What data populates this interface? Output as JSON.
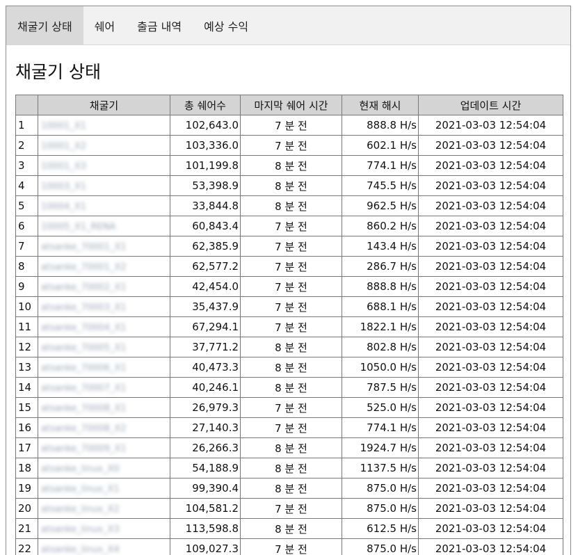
{
  "tabs": [
    {
      "label": "채굴기 상태",
      "active": true
    },
    {
      "label": "쉐어",
      "active": false
    },
    {
      "label": "출금 내역",
      "active": false
    },
    {
      "label": "예상 수익",
      "active": false
    }
  ],
  "page_title": "채굴기 상태",
  "table": {
    "headers": [
      "",
      "채굴기",
      "총 쉐어수",
      "마지막 쉐어 시간",
      "현재 해시",
      "업데이트 시간"
    ],
    "rows": [
      {
        "idx": "1",
        "name": "10001_X1",
        "shares": "102,643.0",
        "last": "7 분 전",
        "hash": "888.8 H/s",
        "updated": "2021-03-03 12:54:04"
      },
      {
        "idx": "2",
        "name": "10001_X2",
        "shares": "103,336.0",
        "last": "7 분 전",
        "hash": "602.1 H/s",
        "updated": "2021-03-03 12:54:04"
      },
      {
        "idx": "3",
        "name": "10001_X3",
        "shares": "101,199.8",
        "last": "8 분 전",
        "hash": "774.1 H/s",
        "updated": "2021-03-03 12:54:04"
      },
      {
        "idx": "4",
        "name": "10003_X1",
        "shares": "53,398.9",
        "last": "8 분 전",
        "hash": "745.5 H/s",
        "updated": "2021-03-03 12:54:04"
      },
      {
        "idx": "5",
        "name": "10004_X1",
        "shares": "33,844.8",
        "last": "8 분 전",
        "hash": "962.5 H/s",
        "updated": "2021-03-03 12:54:04"
      },
      {
        "idx": "6",
        "name": "10005_X1_RENA",
        "shares": "60,843.4",
        "last": "7 분 전",
        "hash": "860.2 H/s",
        "updated": "2021-03-03 12:54:04"
      },
      {
        "idx": "7",
        "name": "atsanke_70001_X1",
        "shares": "62,385.9",
        "last": "7 분 전",
        "hash": "143.4 H/s",
        "updated": "2021-03-03 12:54:04"
      },
      {
        "idx": "8",
        "name": "atsanke_70001_X2",
        "shares": "62,577.2",
        "last": "7 분 전",
        "hash": "286.7 H/s",
        "updated": "2021-03-03 12:54:04"
      },
      {
        "idx": "9",
        "name": "atsanke_70002_X1",
        "shares": "42,454.0",
        "last": "7 분 전",
        "hash": "888.8 H/s",
        "updated": "2021-03-03 12:54:04"
      },
      {
        "idx": "10",
        "name": "atsanke_70003_X1",
        "shares": "35,437.9",
        "last": "7 분 전",
        "hash": "688.1 H/s",
        "updated": "2021-03-03 12:54:04"
      },
      {
        "idx": "11",
        "name": "atsanke_70004_X1",
        "shares": "67,294.1",
        "last": "7 분 전",
        "hash": "1822.1 H/s",
        "updated": "2021-03-03 12:54:04"
      },
      {
        "idx": "12",
        "name": "atsanke_70005_X1",
        "shares": "37,771.2",
        "last": "8 분 전",
        "hash": "802.8 H/s",
        "updated": "2021-03-03 12:54:04"
      },
      {
        "idx": "13",
        "name": "atsanke_70006_X1",
        "shares": "40,473.3",
        "last": "8 분 전",
        "hash": "1050.0 H/s",
        "updated": "2021-03-03 12:54:04"
      },
      {
        "idx": "14",
        "name": "atsanke_70007_X1",
        "shares": "40,246.1",
        "last": "8 분 전",
        "hash": "787.5 H/s",
        "updated": "2021-03-03 12:54:04"
      },
      {
        "idx": "15",
        "name": "atsanke_70008_X1",
        "shares": "26,979.3",
        "last": "7 분 전",
        "hash": "525.0 H/s",
        "updated": "2021-03-03 12:54:04"
      },
      {
        "idx": "16",
        "name": "atsanke_70008_X2",
        "shares": "27,140.3",
        "last": "7 분 전",
        "hash": "774.1 H/s",
        "updated": "2021-03-03 12:54:04"
      },
      {
        "idx": "17",
        "name": "atsanke_70009_X1",
        "shares": "26,266.3",
        "last": "8 분 전",
        "hash": "1924.7 H/s",
        "updated": "2021-03-03 12:54:04"
      },
      {
        "idx": "18",
        "name": "atsanke_linux_X0",
        "shares": "54,188.9",
        "last": "8 분 전",
        "hash": "1137.5 H/s",
        "updated": "2021-03-03 12:54:04"
      },
      {
        "idx": "19",
        "name": "atsanke_linux_X1",
        "shares": "99,390.4",
        "last": "8 분 전",
        "hash": "875.0 H/s",
        "updated": "2021-03-03 12:54:04"
      },
      {
        "idx": "20",
        "name": "atsanke_linux_X2",
        "shares": "104,581.2",
        "last": "7 분 전",
        "hash": "875.0 H/s",
        "updated": "2021-03-03 12:54:04"
      },
      {
        "idx": "21",
        "name": "atsanke_linux_X3",
        "shares": "113,598.8",
        "last": "8 분 전",
        "hash": "612.5 H/s",
        "updated": "2021-03-03 12:54:04"
      },
      {
        "idx": "22",
        "name": "atsanke_linux_X4",
        "shares": "109,027.3",
        "last": "7 분 전",
        "hash": "875.0 H/s",
        "updated": "2021-03-03 12:54:04"
      }
    ]
  },
  "colors": {
    "tab_bar_bg": "#f1f1f1",
    "active_tab_bg": "#d9d9d9",
    "header_bg": "#d4d4d4",
    "border": "#777777"
  }
}
